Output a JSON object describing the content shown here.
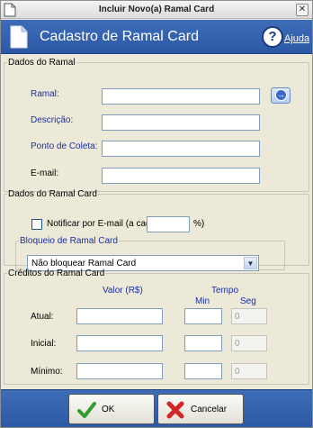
{
  "window": {
    "title": "Incluir Novo(a) Ramal Card",
    "close_glyph": "✕"
  },
  "header": {
    "heading": "Cadastro de Ramal Card",
    "help_label": "Ajuda",
    "help_glyph": "?"
  },
  "dados_ramal": {
    "legend": "Dados do Ramal",
    "fields": [
      {
        "label": "Ramal:",
        "value": ""
      },
      {
        "label": "Descrição:",
        "value": ""
      },
      {
        "label": "Ponto de Coleta:",
        "value": ""
      },
      {
        "label": "E-mail:",
        "value": ""
      }
    ],
    "lookup_glyph": "→"
  },
  "dados_card": {
    "legend": "Dados do Ramal Card",
    "notify_label": "Notificar por E-mail (a cada",
    "notify_checked": false,
    "notify_value": "",
    "notify_suffix": "%)",
    "bloqueio_legend": "Bloqueio de Ramal Card",
    "bloqueio_selected": "Não bloquear Ramal Card"
  },
  "creditos": {
    "legend": "Créditos do Ramal Card",
    "col_valor": "Valor (R$)",
    "col_tempo": "Tempo",
    "col_min": "Min",
    "col_seg": "Seg",
    "rows": [
      {
        "label": "Atual:",
        "valor": "",
        "min": "",
        "seg": "0"
      },
      {
        "label": "Inicial:",
        "valor": "",
        "min": "",
        "seg": "0"
      },
      {
        "label": "Mínimo:",
        "valor": "",
        "min": "",
        "seg": "0"
      }
    ]
  },
  "footer": {
    "ok_label": "OK",
    "cancel_label": "Cancelar"
  },
  "colors": {
    "banner": "#2C58A6",
    "ok_green": "#2E9E2E",
    "cancel_red": "#D42525",
    "label_blue": "#1B2FA0"
  }
}
